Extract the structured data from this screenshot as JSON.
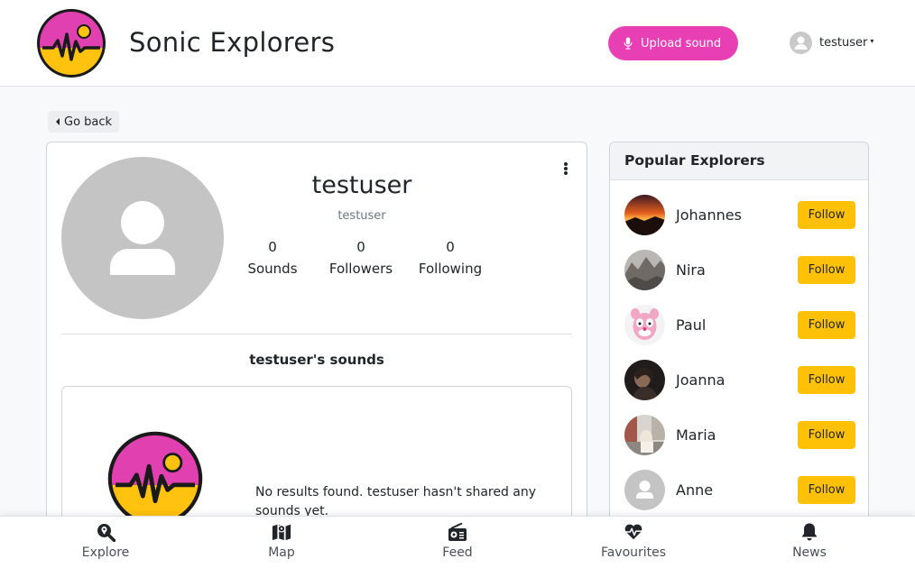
{
  "header": {
    "brand": "Sonic Explorers",
    "upload_label": "Upload sound",
    "username": "testuser",
    "accent_color": "#e83fb5"
  },
  "nav": {
    "go_back": "Go back"
  },
  "profile": {
    "name": "testuser",
    "handle": "testuser",
    "stats": [
      {
        "value": "0",
        "label": "Sounds"
      },
      {
        "value": "0",
        "label": "Followers"
      },
      {
        "value": "0",
        "label": "Following"
      }
    ],
    "sounds_title": "testuser's sounds",
    "empty_message": "No results found. testuser hasn't shared any sounds yet."
  },
  "popular": {
    "title": "Popular Explorers",
    "follow_label": "Follow",
    "follow_color": "#ffc107",
    "explorers": [
      {
        "name": "Johannes",
        "avatar": "sunset-photo"
      },
      {
        "name": "Nira",
        "avatar": "mountain-photo"
      },
      {
        "name": "Paul",
        "avatar": "pink-panther-image"
      },
      {
        "name": "Joanna",
        "avatar": "dark-portrait-photo"
      },
      {
        "name": "Maria",
        "avatar": "street-photo"
      },
      {
        "name": "Anne",
        "avatar": "default-user-icon"
      }
    ]
  },
  "bottom_nav": [
    {
      "label": "Explore",
      "icon": "search-location-icon"
    },
    {
      "label": "Map",
      "icon": "map-icon"
    },
    {
      "label": "Feed",
      "icon": "radio-icon"
    },
    {
      "label": "Favourites",
      "icon": "heartbeat-icon"
    },
    {
      "label": "News",
      "icon": "bell-icon"
    }
  ]
}
